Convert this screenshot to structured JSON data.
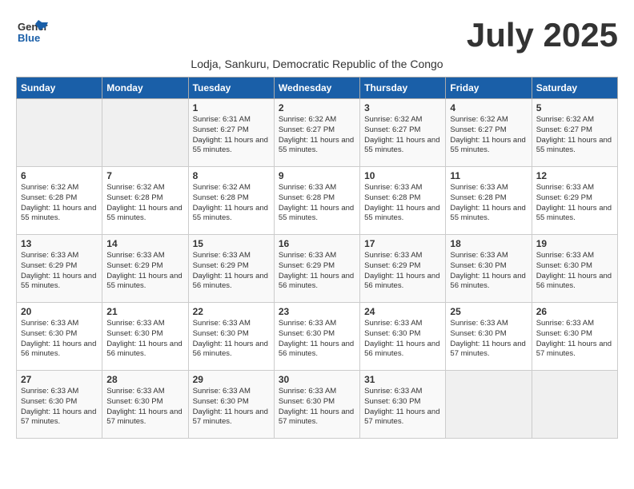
{
  "logo": {
    "general": "General",
    "blue": "Blue"
  },
  "title": "July 2025",
  "subtitle": "Lodja, Sankuru, Democratic Republic of the Congo",
  "days_of_week": [
    "Sunday",
    "Monday",
    "Tuesday",
    "Wednesday",
    "Thursday",
    "Friday",
    "Saturday"
  ],
  "weeks": [
    [
      {
        "day": "",
        "info": ""
      },
      {
        "day": "",
        "info": ""
      },
      {
        "day": "1",
        "info": "Sunrise: 6:31 AM\nSunset: 6:27 PM\nDaylight: 11 hours and 55 minutes."
      },
      {
        "day": "2",
        "info": "Sunrise: 6:32 AM\nSunset: 6:27 PM\nDaylight: 11 hours and 55 minutes."
      },
      {
        "day": "3",
        "info": "Sunrise: 6:32 AM\nSunset: 6:27 PM\nDaylight: 11 hours and 55 minutes."
      },
      {
        "day": "4",
        "info": "Sunrise: 6:32 AM\nSunset: 6:27 PM\nDaylight: 11 hours and 55 minutes."
      },
      {
        "day": "5",
        "info": "Sunrise: 6:32 AM\nSunset: 6:27 PM\nDaylight: 11 hours and 55 minutes."
      }
    ],
    [
      {
        "day": "6",
        "info": "Sunrise: 6:32 AM\nSunset: 6:28 PM\nDaylight: 11 hours and 55 minutes."
      },
      {
        "day": "7",
        "info": "Sunrise: 6:32 AM\nSunset: 6:28 PM\nDaylight: 11 hours and 55 minutes."
      },
      {
        "day": "8",
        "info": "Sunrise: 6:32 AM\nSunset: 6:28 PM\nDaylight: 11 hours and 55 minutes."
      },
      {
        "day": "9",
        "info": "Sunrise: 6:33 AM\nSunset: 6:28 PM\nDaylight: 11 hours and 55 minutes."
      },
      {
        "day": "10",
        "info": "Sunrise: 6:33 AM\nSunset: 6:28 PM\nDaylight: 11 hours and 55 minutes."
      },
      {
        "day": "11",
        "info": "Sunrise: 6:33 AM\nSunset: 6:28 PM\nDaylight: 11 hours and 55 minutes."
      },
      {
        "day": "12",
        "info": "Sunrise: 6:33 AM\nSunset: 6:29 PM\nDaylight: 11 hours and 55 minutes."
      }
    ],
    [
      {
        "day": "13",
        "info": "Sunrise: 6:33 AM\nSunset: 6:29 PM\nDaylight: 11 hours and 55 minutes."
      },
      {
        "day": "14",
        "info": "Sunrise: 6:33 AM\nSunset: 6:29 PM\nDaylight: 11 hours and 55 minutes."
      },
      {
        "day": "15",
        "info": "Sunrise: 6:33 AM\nSunset: 6:29 PM\nDaylight: 11 hours and 56 minutes."
      },
      {
        "day": "16",
        "info": "Sunrise: 6:33 AM\nSunset: 6:29 PM\nDaylight: 11 hours and 56 minutes."
      },
      {
        "day": "17",
        "info": "Sunrise: 6:33 AM\nSunset: 6:29 PM\nDaylight: 11 hours and 56 minutes."
      },
      {
        "day": "18",
        "info": "Sunrise: 6:33 AM\nSunset: 6:30 PM\nDaylight: 11 hours and 56 minutes."
      },
      {
        "day": "19",
        "info": "Sunrise: 6:33 AM\nSunset: 6:30 PM\nDaylight: 11 hours and 56 minutes."
      }
    ],
    [
      {
        "day": "20",
        "info": "Sunrise: 6:33 AM\nSunset: 6:30 PM\nDaylight: 11 hours and 56 minutes."
      },
      {
        "day": "21",
        "info": "Sunrise: 6:33 AM\nSunset: 6:30 PM\nDaylight: 11 hours and 56 minutes."
      },
      {
        "day": "22",
        "info": "Sunrise: 6:33 AM\nSunset: 6:30 PM\nDaylight: 11 hours and 56 minutes."
      },
      {
        "day": "23",
        "info": "Sunrise: 6:33 AM\nSunset: 6:30 PM\nDaylight: 11 hours and 56 minutes."
      },
      {
        "day": "24",
        "info": "Sunrise: 6:33 AM\nSunset: 6:30 PM\nDaylight: 11 hours and 56 minutes."
      },
      {
        "day": "25",
        "info": "Sunrise: 6:33 AM\nSunset: 6:30 PM\nDaylight: 11 hours and 57 minutes."
      },
      {
        "day": "26",
        "info": "Sunrise: 6:33 AM\nSunset: 6:30 PM\nDaylight: 11 hours and 57 minutes."
      }
    ],
    [
      {
        "day": "27",
        "info": "Sunrise: 6:33 AM\nSunset: 6:30 PM\nDaylight: 11 hours and 57 minutes."
      },
      {
        "day": "28",
        "info": "Sunrise: 6:33 AM\nSunset: 6:30 PM\nDaylight: 11 hours and 57 minutes."
      },
      {
        "day": "29",
        "info": "Sunrise: 6:33 AM\nSunset: 6:30 PM\nDaylight: 11 hours and 57 minutes."
      },
      {
        "day": "30",
        "info": "Sunrise: 6:33 AM\nSunset: 6:30 PM\nDaylight: 11 hours and 57 minutes."
      },
      {
        "day": "31",
        "info": "Sunrise: 6:33 AM\nSunset: 6:30 PM\nDaylight: 11 hours and 57 minutes."
      },
      {
        "day": "",
        "info": ""
      },
      {
        "day": "",
        "info": ""
      }
    ]
  ]
}
